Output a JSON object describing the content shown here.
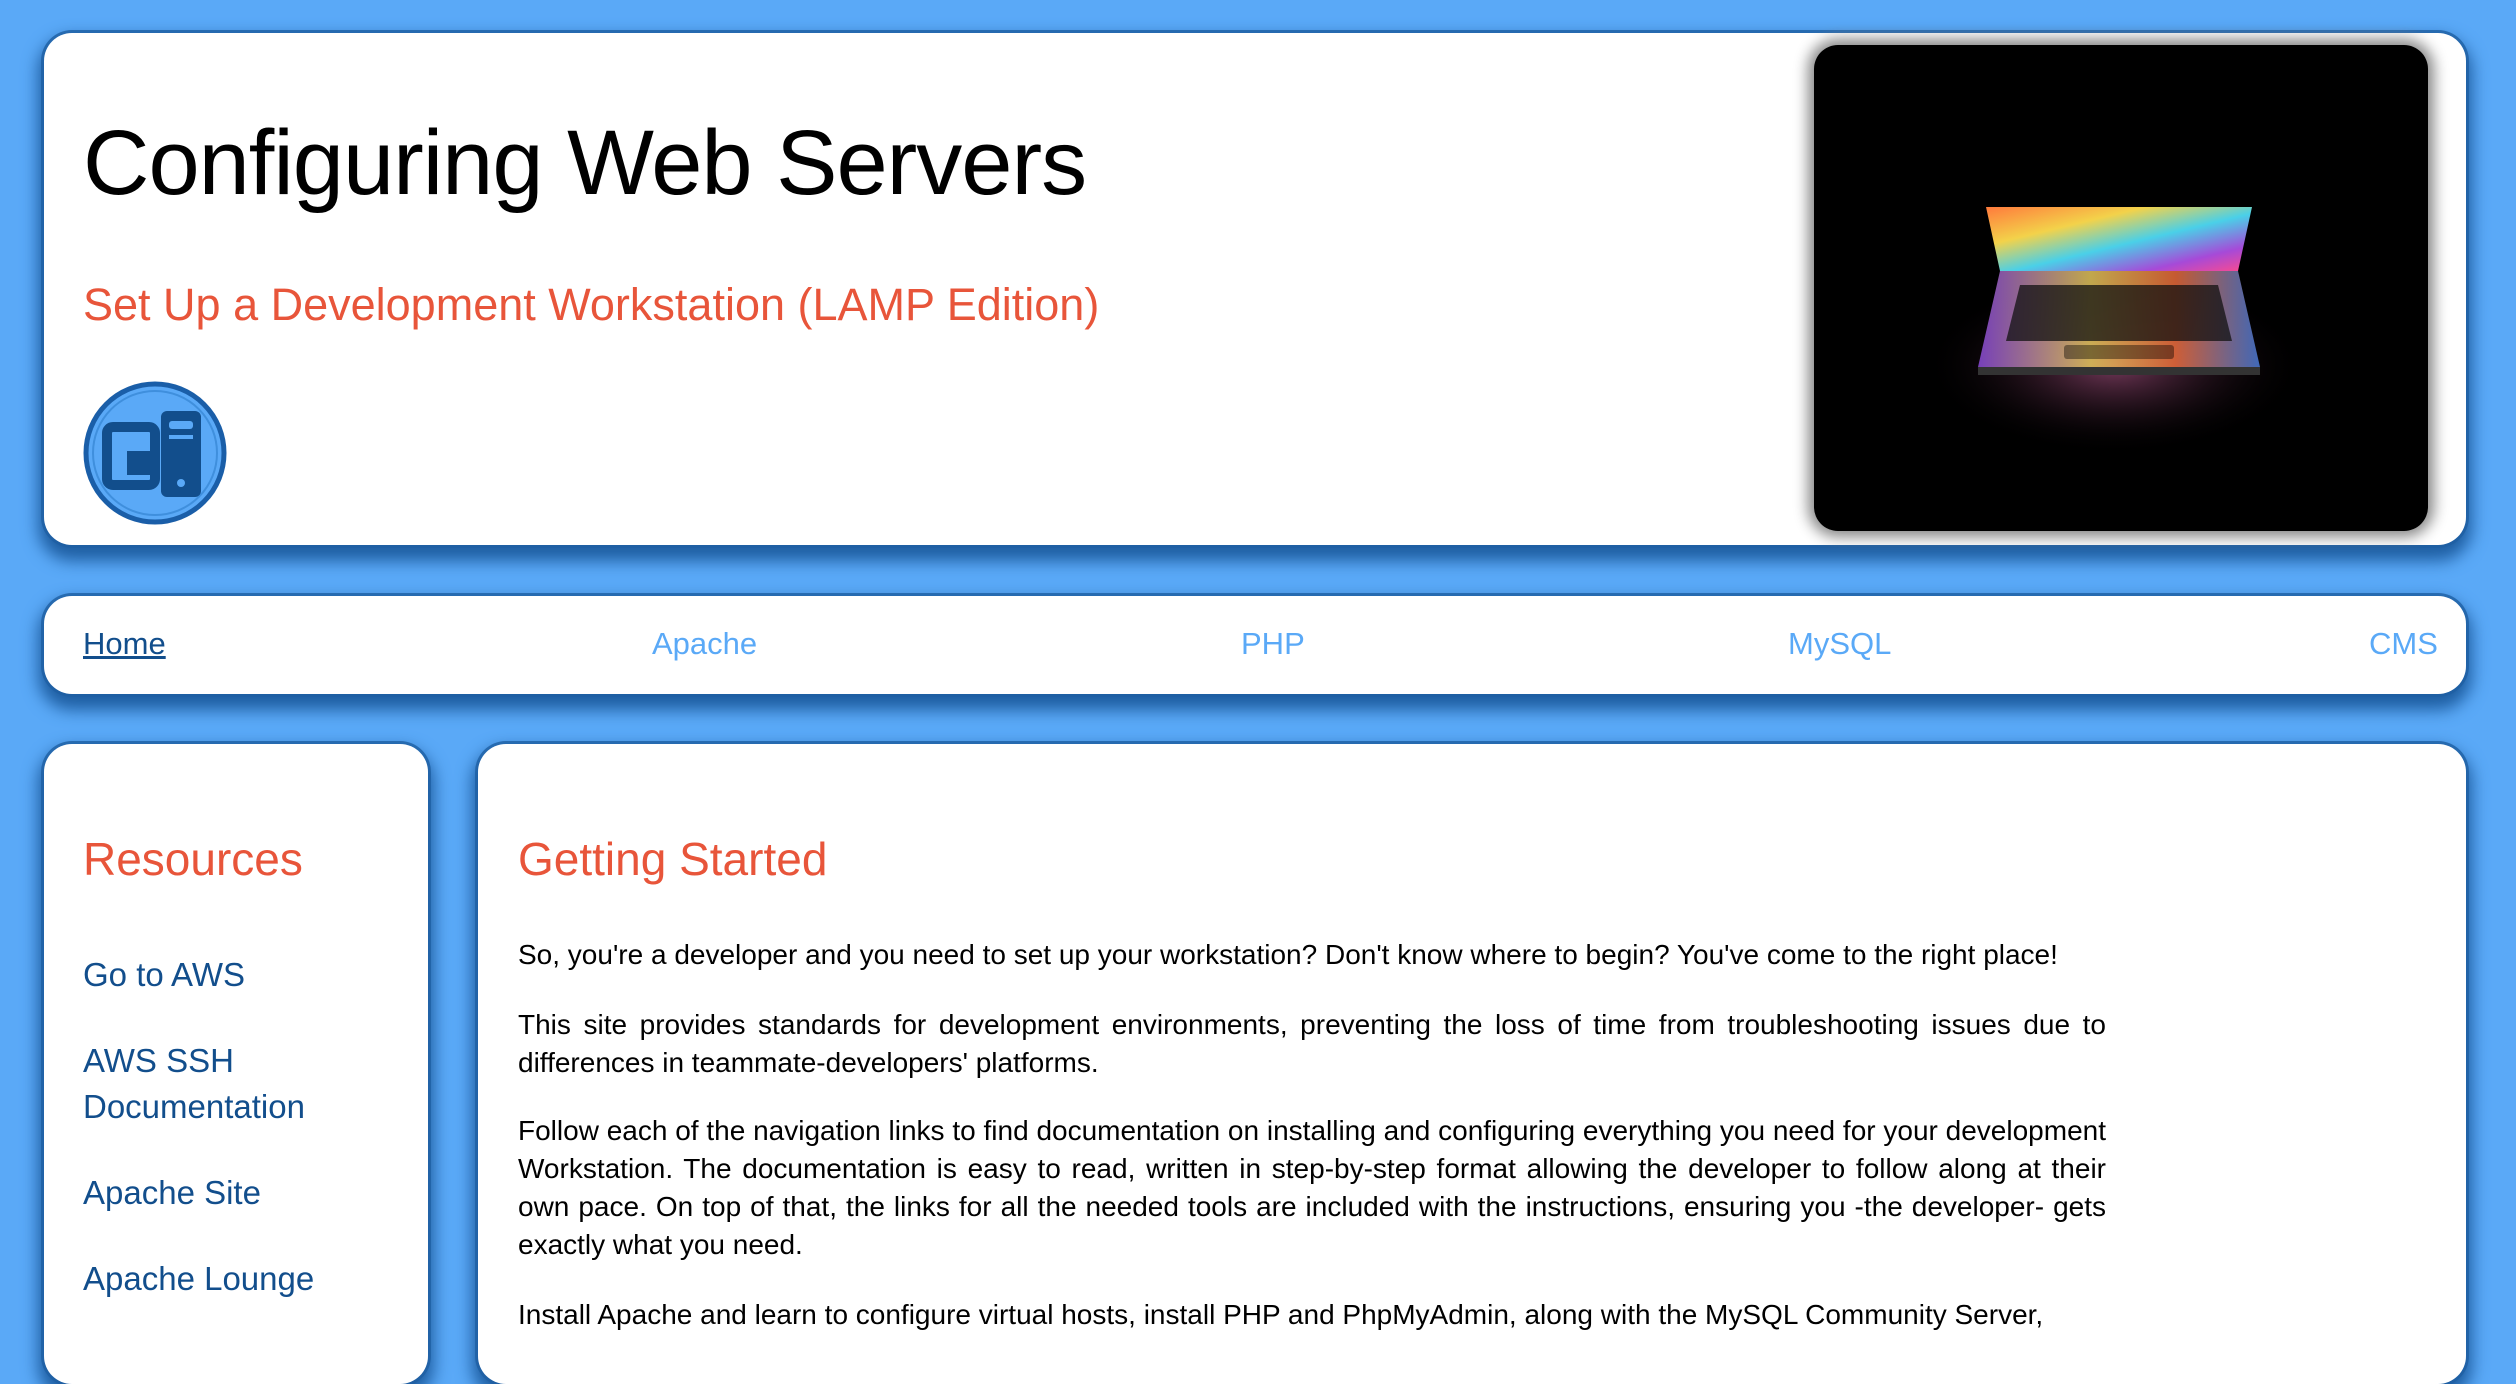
{
  "header": {
    "title": "Configuring Web Servers",
    "subtitle": "Set Up a Development Workstation (LAMP Edition)",
    "logo_icon": "server-logo-icon",
    "hero_image": "laptop-image"
  },
  "nav": {
    "items": [
      {
        "label": "Home",
        "active": true
      },
      {
        "label": "Apache"
      },
      {
        "label": "PHP"
      },
      {
        "label": "MySQL"
      },
      {
        "label": "CMS"
      }
    ]
  },
  "sidebar": {
    "title": "Resources",
    "links": [
      {
        "label": "Go to AWS"
      },
      {
        "label": "AWS SSH Documentation"
      },
      {
        "label": "Apache Site"
      },
      {
        "label": "Apache Lounge"
      }
    ]
  },
  "main": {
    "title": "Getting Started",
    "paragraphs": [
      "So, you're a developer and you need to set up your workstation? Don't know where to begin? You've come to the right place!",
      "This site provides standards for development environments, preventing the loss of time from troubleshooting issues due to differences in teammate-developers' platforms.",
      "Follow each of the navigation links to find documentation on installing and configuring everything you need for your development Workstation. The documentation is easy to read, written in step-by-step format allowing the developer to follow along at their own pace. On top of that, the links for all the needed tools are included with the instructions, ensuring you -the developer- gets exactly what you need.",
      "Install Apache and learn to configure virtual hosts, install PHP and PhpMyAdmin, along with the MySQL Community Server,"
    ]
  },
  "colors": {
    "background": "#5aa9f7",
    "accent": "#e8553a",
    "link_dark": "#124e8c",
    "link_light": "#5aa9f7"
  }
}
